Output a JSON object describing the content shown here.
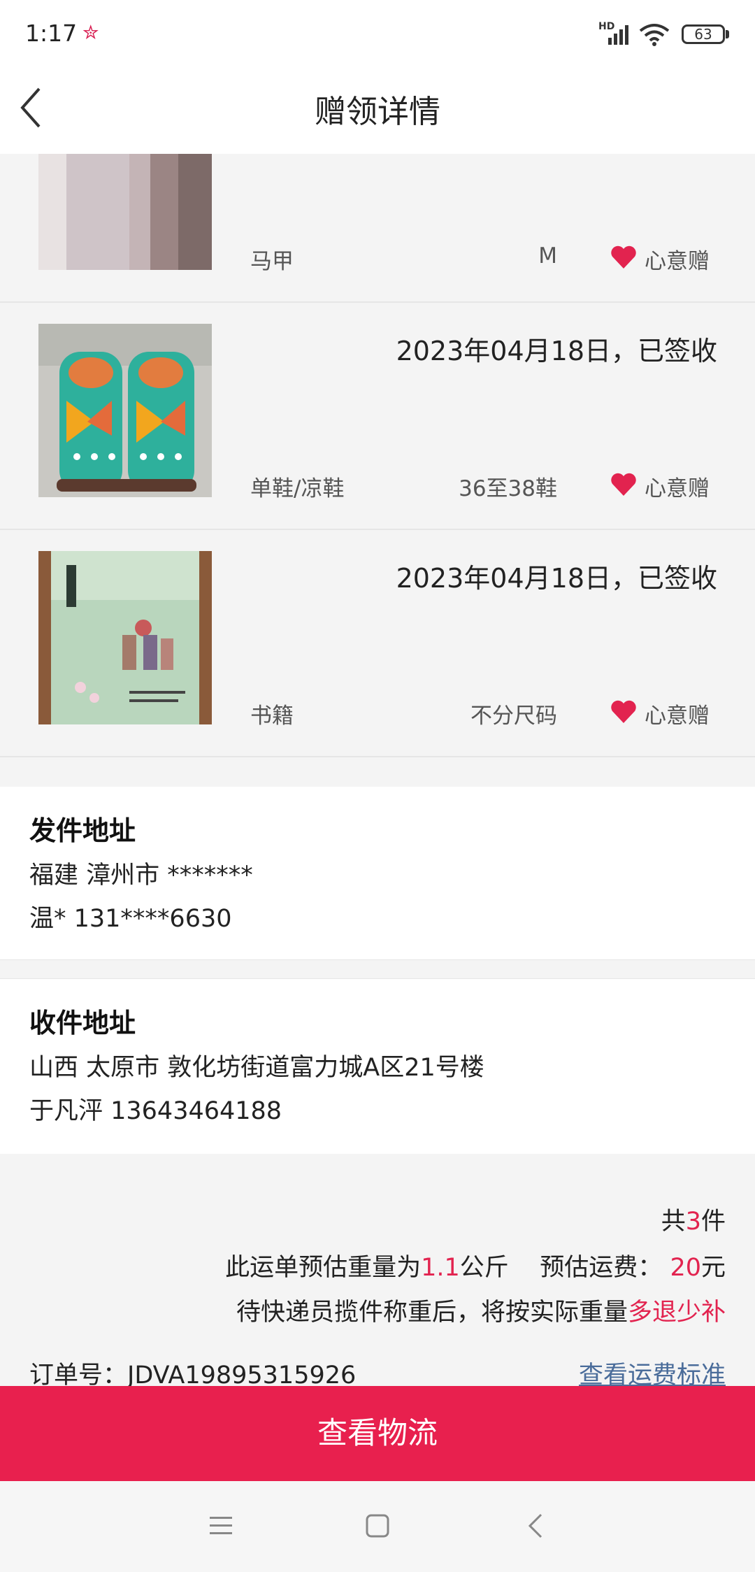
{
  "status_bar": {
    "time": "1:17",
    "network": "HD",
    "battery": "63"
  },
  "header": {
    "title": "赠领详情"
  },
  "items": [
    {
      "date": "",
      "category": "马甲",
      "size": "M",
      "tag": "心意赠",
      "photo": "vest"
    },
    {
      "date": "2023年04月18日，已签收",
      "category": "单鞋/凉鞋",
      "size": "36至38鞋",
      "tag": "心意赠",
      "photo": "knit-slippers"
    },
    {
      "date": "2023年04月18日，已签收",
      "category": "书籍",
      "size": "不分尺码",
      "tag": "心意赠",
      "photo": "book"
    }
  ],
  "sender": {
    "heading": "发件地址",
    "address": "福建 漳州市 *******",
    "contact": "温* 131****6630"
  },
  "receiver": {
    "heading": "收件地址",
    "address": "山西 太原市 敦化坊街道富力城A区21号楼",
    "contact": "于凡泙 13643464188"
  },
  "summary": {
    "count_prefix": "共",
    "count": "3",
    "count_suffix": "件",
    "weight_prefix": "此运单预估重量为",
    "weight": "1.1",
    "weight_unit": "公斤",
    "fee_label": "预估运费：",
    "fee": "20",
    "fee_unit": "元",
    "note_prefix": "待快递员揽件称重后，将按实际重量",
    "note_highlight": "多退少补"
  },
  "order": {
    "label": "订单号：",
    "number": "JDVA19895315926",
    "fee_link": "查看运费标准"
  },
  "button": {
    "track": "查看物流"
  },
  "colors": {
    "accent": "#e8204e",
    "link": "#4a6c9a",
    "background": "#f4f4f4"
  }
}
